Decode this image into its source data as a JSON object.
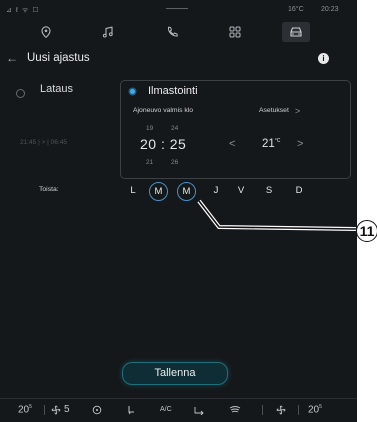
{
  "status_bar": {
    "signal": "⊿ ℓ ᯤ ☐",
    "temperature": "16°C",
    "time": "20:23"
  },
  "top_nav": {
    "items": [
      {
        "name": "navigation",
        "icon": "map-pin-icon"
      },
      {
        "name": "music",
        "icon": "music-note-icon"
      },
      {
        "name": "phone",
        "icon": "phone-icon"
      },
      {
        "name": "apps",
        "icon": "apps-grid-icon"
      },
      {
        "name": "vehicle",
        "icon": "car-icon",
        "active": true
      }
    ]
  },
  "header": {
    "back_icon": "arrow-left-icon",
    "title": "Uusi ajastus",
    "info_icon": "info-icon",
    "info_glyph": "i"
  },
  "left_option": {
    "label": "Lataus",
    "times": "21:45  |  >  |  06:45"
  },
  "panel": {
    "title": "Ilmastointi",
    "ready_label": "Ajoneuvo valmis klo",
    "settings_label": "Asetukset",
    "settings_chevron": ">",
    "time_hour_prev": "19",
    "time_min_prev": "24",
    "time_value": "20 : 25",
    "time_hour_next": "21",
    "time_min_next": "26",
    "temp_dec": "<",
    "temp_value": "21",
    "temp_unit": "°C",
    "temp_inc": ">"
  },
  "repeat": {
    "label": "Toista:",
    "days": [
      {
        "label": "L",
        "selected": false
      },
      {
        "label": "M",
        "selected": true
      },
      {
        "label": "M",
        "selected": true
      },
      {
        "label": "J",
        "selected": false
      },
      {
        "label": "V",
        "selected": false
      },
      {
        "label": "S",
        "selected": false
      },
      {
        "label": "D",
        "selected": false
      }
    ]
  },
  "save_button": "Tallenna",
  "bottom_bar": {
    "left_temp": "20",
    "left_temp_suffix": "5",
    "fan_speed": "5",
    "ac_label": "A/C",
    "right_temp": "20",
    "right_temp_suffix": "5"
  },
  "callout": {
    "number": "11"
  },
  "colors": {
    "accent": "#4a90c8",
    "background": "#15181b",
    "save_glow": "#1d6f7c"
  }
}
